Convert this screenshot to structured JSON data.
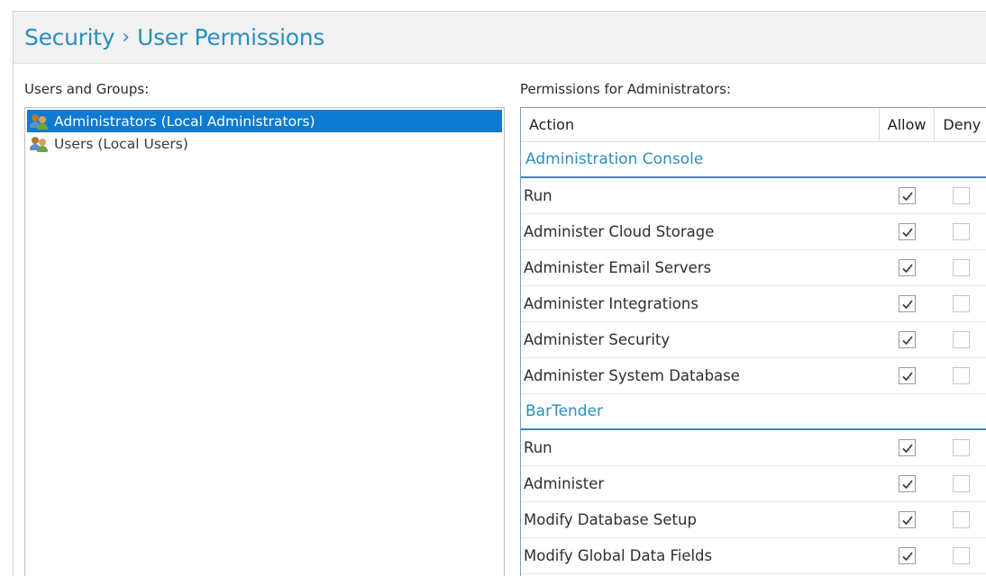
{
  "header": {
    "breadcrumb_root": "Security",
    "breadcrumb_sep": "›",
    "breadcrumb_current": "User Permissions"
  },
  "users_panel": {
    "label": "Users and Groups:",
    "items": [
      {
        "label": "Administrators (Local Administrators)",
        "selected": true,
        "icon": "user-group-icon"
      },
      {
        "label": "Users (Local Users)",
        "selected": false,
        "icon": "user-group-icon"
      }
    ]
  },
  "permissions_panel": {
    "label": "Permissions for Administrators:",
    "columns": {
      "action": "Action",
      "allow": "Allow",
      "deny": "Deny"
    },
    "groups": [
      {
        "name": "Administration Console",
        "rows": [
          {
            "action": "Run",
            "allow": true,
            "deny": false
          },
          {
            "action": "Administer Cloud Storage",
            "allow": true,
            "deny": false
          },
          {
            "action": "Administer Email Servers",
            "allow": true,
            "deny": false
          },
          {
            "action": "Administer Integrations",
            "allow": true,
            "deny": false
          },
          {
            "action": "Administer Security",
            "allow": true,
            "deny": false
          },
          {
            "action": "Administer System Database",
            "allow": true,
            "deny": false
          }
        ]
      },
      {
        "name": "BarTender",
        "rows": [
          {
            "action": "Run",
            "allow": true,
            "deny": false
          },
          {
            "action": "Administer",
            "allow": true,
            "deny": false
          },
          {
            "action": "Modify Database Setup",
            "allow": true,
            "deny": false
          },
          {
            "action": "Modify Global Data Fields",
            "allow": true,
            "deny": false
          }
        ]
      }
    ]
  },
  "colors": {
    "accent": "#2a8fbd",
    "selection": "#0e7ad2"
  }
}
